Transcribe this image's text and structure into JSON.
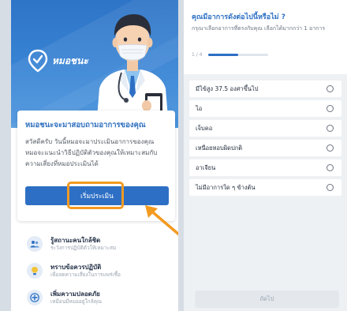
{
  "brand": {
    "name": "หมอชนะ"
  },
  "card": {
    "title": "หมอชนะจะมาสอบถามอาการของคุณ",
    "description": "สวัสดีครับ วันนี้หมอจะมาประเมินอาการของคุณ หมอจะแนะนำวิธีปฏิบัติตัวของคุณให้เหมาะสมกับความเสี่ยงที่หมอประเมินได้",
    "start_button": "เริ่มประเมิน"
  },
  "features": [
    {
      "icon": "people-icon",
      "title": "รู้สถานะคนใกล้ชิด",
      "subtitle": "ระวังการปฏิบัติตัวให้เหมาะสม"
    },
    {
      "icon": "lightbulb-icon",
      "title": "ทราบข้อควรปฏิบัติ",
      "subtitle": "เพื่อลดความเสี่ยงในการแพร่เชื้อ"
    },
    {
      "icon": "plus-icon",
      "title": "เพิ่มความปลอดภัย",
      "subtitle": "เหมือนมีหมออยู่ใกล้คุณ"
    }
  ],
  "question": {
    "title": "คุณมีอาการดังต่อไปนี้หรือไม่ ?",
    "subtitle": "กรุณาเลือกอาการที่ตรงกับคุณ เลือกได้มากกว่า 1 อาการ",
    "step": "1 / 4",
    "progress": 0.5,
    "options": [
      "มีไข้สูง 37.5 องศาขึ้นไป",
      "ไอ",
      "เจ็บคอ",
      "เหนื่อยหอบผิดปกติ",
      "อาเจียน",
      "ไม่มีอาการใด ๆ ข้างต้น"
    ],
    "next_button": "ถัดไป"
  },
  "colors": {
    "primary": "#2d6fc4",
    "highlight": "#f39a21",
    "panel_bg": "#eef1f4"
  }
}
